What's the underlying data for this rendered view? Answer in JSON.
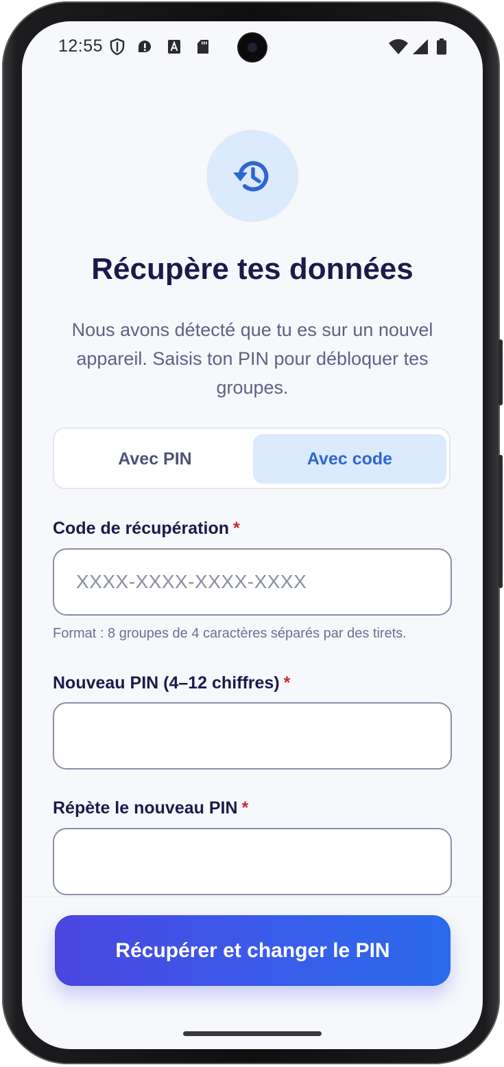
{
  "status_bar": {
    "time": "12:55",
    "left_icons": [
      "shield-icon",
      "chat-alert-icon",
      "a-badge-icon",
      "sd-card-icon"
    ],
    "right_icons": [
      "wifi-icon",
      "signal-icon",
      "battery-icon"
    ]
  },
  "hero": {
    "icon": "history-restore-icon",
    "icon_color": "#2f66d4",
    "circle_color": "#dceafd"
  },
  "header": {
    "title": "Récupère tes données",
    "subtitle": "Nous avons détecté que tu es sur un nouvel appareil. Saisis ton PIN pour débloquer tes groupes."
  },
  "mode_toggle": {
    "options": [
      "Avec PIN",
      "Avec code"
    ],
    "selected": "Avec code"
  },
  "form": {
    "recovery_code": {
      "label": "Code de récupération",
      "required_mark": "*",
      "placeholder": "XXXX-XXXX-XXXX-XXXX",
      "value": "",
      "hint": "Format : 8 groupes de 4 caractères séparés par des tirets."
    },
    "new_pin": {
      "label": "Nouveau PIN (4–12 chiffres)",
      "required_mark": "*",
      "value": ""
    },
    "repeat_pin": {
      "label": "Répète le nouveau PIN",
      "required_mark": "*",
      "value": ""
    }
  },
  "submit": {
    "label": "Récupérer et changer le PIN"
  },
  "colors": {
    "accent": "#2f66d4",
    "title": "#1c1a4a",
    "required": "#d02a2a",
    "cta_gradient": [
      "#4a46e0",
      "#2a6aec"
    ]
  }
}
